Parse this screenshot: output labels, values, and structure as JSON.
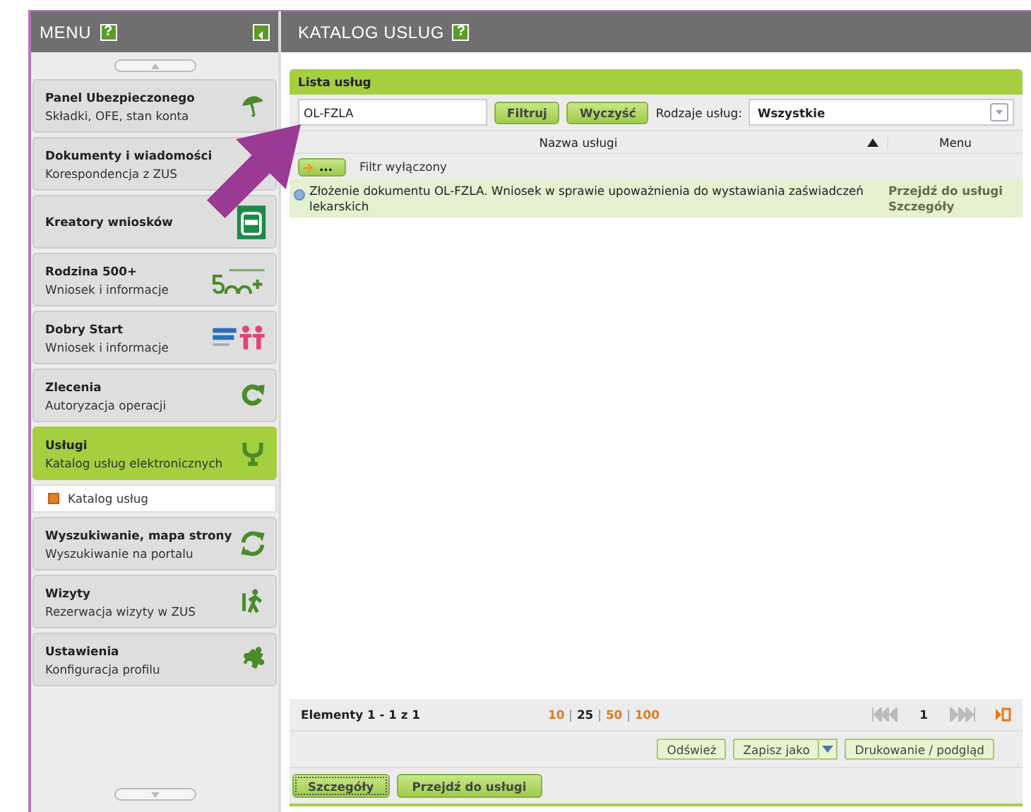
{
  "sidebar": {
    "title": "MENU",
    "help": "?",
    "items": [
      {
        "title": "Panel Ubezpieczonego",
        "subtitle": "Składki, OFE, stan konta",
        "selected": false
      },
      {
        "title": "Dokumenty i wiadomości",
        "subtitle": "Korespondencja z ZUS",
        "selected": false
      },
      {
        "title": "Kreatory wniosków",
        "selected": false
      },
      {
        "title": "Rodzina 500+",
        "subtitle": "Wniosek i informacje",
        "selected": false
      },
      {
        "title": "Dobry Start",
        "subtitle": "Wniosek i informacje",
        "selected": false
      },
      {
        "title": "Zlecenia",
        "subtitle": "Autoryzacja operacji",
        "selected": false
      },
      {
        "title": "Usługi",
        "subtitle": "Katalog usług elektronicznych",
        "selected": true,
        "children": [
          {
            "label": "Katalog usług",
            "selected": true
          }
        ]
      },
      {
        "title": "Wyszukiwanie, mapa strony",
        "subtitle": "Wyszukiwanie na portalu",
        "selected": false
      },
      {
        "title": "Wizyty",
        "subtitle": "Rezerwacja wizyty w ZUS",
        "selected": false
      },
      {
        "title": "Ustawienia",
        "subtitle": "Konfiguracja profilu",
        "selected": false
      }
    ]
  },
  "main": {
    "title": "KATALOG USLUG",
    "help": "?",
    "panel": {
      "title": "Lista usług",
      "filter": {
        "value": "OL-FZLA",
        "buttons": [
          "Filtruj",
          "Wyczyść"
        ],
        "type_label": "Rodzaje usług:",
        "type_value": "Wszystkie"
      },
      "table": {
        "columns": [
          "Nazwa usługi",
          "Menu"
        ],
        "filter_button": "...",
        "filter_status": "Filtr wyłączony",
        "rows": [
          {
            "name": "Złożenie dokumentu OL-FZLA. Wniosek w sprawie upoważnienia do wystawiania zaświadczeń lekarskich",
            "actions": [
              "Przejdź do usługi",
              "Szczegóły"
            ],
            "selected": true
          }
        ]
      },
      "pager": {
        "summary": "Elementy 1 - 1 z 1",
        "page_sizes": [
          {
            "label": "10",
            "selected": false
          },
          {
            "label": "25",
            "selected": true
          },
          {
            "label": "50",
            "selected": false
          },
          {
            "label": "100",
            "selected": false
          }
        ],
        "separator": "|",
        "page": "1"
      },
      "tools": [
        "Odśwież",
        "Zapisz jako",
        "Drukowanie / podgląd"
      ],
      "actions": [
        "Szczegóły",
        "Przejdź do usługi"
      ]
    }
  }
}
